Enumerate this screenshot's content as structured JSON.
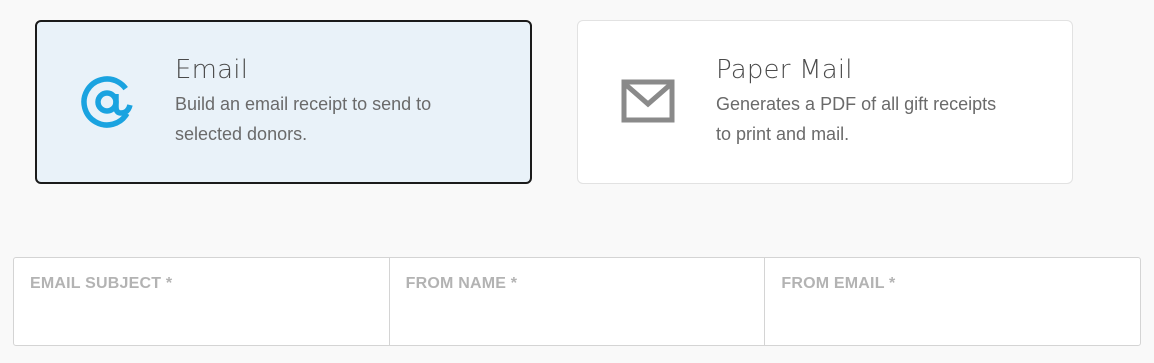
{
  "delivery_options": [
    {
      "title": "Email",
      "description": "Build an email receipt to send to selected donors.",
      "icon": "at-sign-icon",
      "selected": true
    },
    {
      "title": "Paper Mail",
      "description": "Generates a PDF of all gift receipts to print and mail.",
      "icon": "envelope-icon",
      "selected": false
    }
  ],
  "fields": [
    {
      "label": "EMAIL SUBJECT *",
      "value": ""
    },
    {
      "label": "FROM NAME *",
      "value": ""
    },
    {
      "label": "FROM EMAIL *",
      "value": ""
    }
  ],
  "colors": {
    "accent": "#1aa3e0",
    "selected_bg": "#e9f2f9",
    "icon_gray": "#8a8a8a"
  }
}
